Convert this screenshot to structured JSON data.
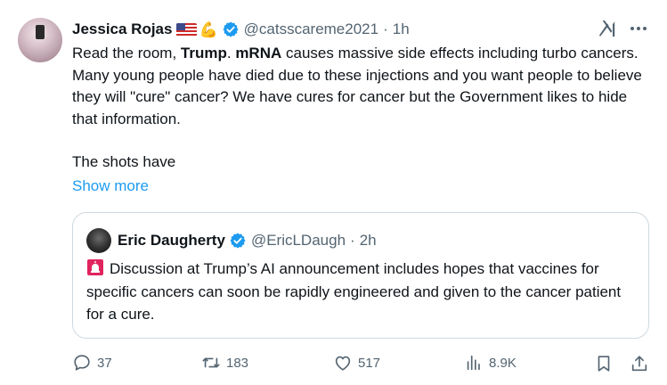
{
  "tweet": {
    "author_name": "Jessica Rojas",
    "author_handle": "@catsscareme2021",
    "separator": "·",
    "time": "1h",
    "text": {
      "t1": "Read the room, ",
      "b1": "Trump",
      "t2": ". ",
      "b2": "mRNA",
      "t3": " causes massive side effects including turbo cancers. Many young people have died due to these injections and you want people to believe they will \"cure\" cancer? We have cures for cancer but the Government likes to hide that information.",
      "p2": "The shots have"
    },
    "show_more_label": "Show more"
  },
  "quote": {
    "author_name": "Eric Daugherty",
    "author_handle": "@EricLDaugh",
    "separator": "·",
    "time": "2h",
    "text": "Discussion at Trump’s AI announcement includes hopes that vaccines for specific cancers can soon be rapidly engineered and given to the cancer patient for a cure."
  },
  "actions": {
    "replies": "37",
    "reposts": "183",
    "likes": "517",
    "views": "8.9K"
  },
  "colors": {
    "verified": "#1d9bf0",
    "link": "#1d9bf0",
    "muted": "#536471",
    "border": "#cfd9de"
  },
  "icons": [
    "flag-us-icon",
    "flexed-biceps-icon",
    "verified-badge-icon",
    "grok-icon",
    "more-icon",
    "siren-icon",
    "reply-icon",
    "repost-icon",
    "like-icon",
    "views-icon",
    "bookmark-icon",
    "share-icon"
  ]
}
